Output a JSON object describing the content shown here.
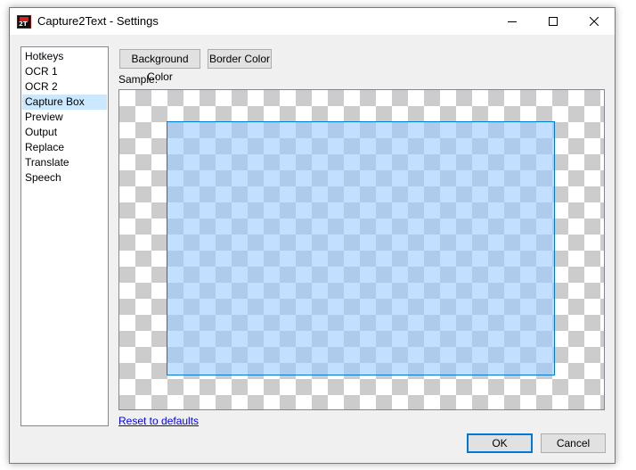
{
  "window": {
    "title": "Capture2Text - Settings",
    "app_icon_text": "2T",
    "controls": {
      "minimize": "minimize-icon",
      "maximize": "maximize-icon",
      "close": "close-icon"
    }
  },
  "sidebar": {
    "items": [
      {
        "label": "Hotkeys",
        "selected": false
      },
      {
        "label": "OCR 1",
        "selected": false
      },
      {
        "label": "OCR 2",
        "selected": false
      },
      {
        "label": "Capture Box",
        "selected": true
      },
      {
        "label": "Preview",
        "selected": false
      },
      {
        "label": "Output",
        "selected": false
      },
      {
        "label": "Replace",
        "selected": false
      },
      {
        "label": "Translate",
        "selected": false
      },
      {
        "label": "Speech",
        "selected": false
      }
    ],
    "selected_color": "#cce8ff"
  },
  "capture_box": {
    "background_color_button": "Background Color",
    "border_color_button": "Border Color",
    "sample_label": "Sample:",
    "box_fill_color": "#99c9ff",
    "box_border_color": "#0078d7",
    "reset_link": "Reset to defaults"
  },
  "footer": {
    "ok_label": "OK",
    "cancel_label": "Cancel"
  }
}
